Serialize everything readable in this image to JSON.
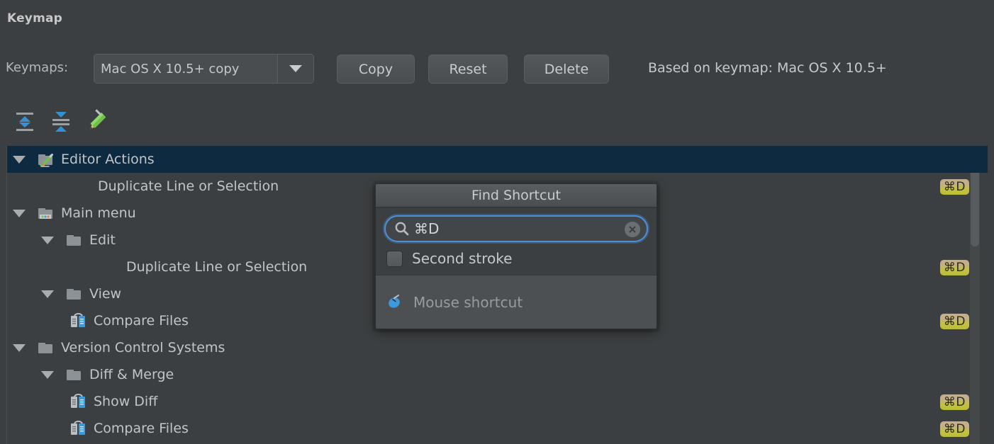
{
  "header": {
    "title": "Keymap",
    "keymaps_label": "Keymaps:",
    "keymap_selected": "Mac OS X 10.5+ copy",
    "buttons": {
      "copy": "Copy",
      "reset": "Reset",
      "delete": "Delete"
    },
    "based_on": "Based on keymap: Mac OS X 10.5+"
  },
  "toolbar": {
    "icons": [
      {
        "name": "expand-all-icon"
      },
      {
        "name": "collapse-all-icon"
      },
      {
        "name": "edit-pencil-icon"
      }
    ],
    "search_value": "",
    "search_placeholder": "",
    "find_shortcut_icon": "find-by-shortcut-icon",
    "clear_icon": "clear-filter-icon"
  },
  "tree": {
    "rows": [
      {
        "label": "Editor Actions",
        "indent": 0,
        "twisty": "expanded",
        "icon": "editor-actions-folder-icon",
        "selected": true,
        "shortcut": ""
      },
      {
        "label": "Duplicate Line or Selection",
        "indent": 3,
        "twisty": "none",
        "icon": "none",
        "selected": false,
        "shortcut": "⌘D"
      },
      {
        "label": "Main menu",
        "indent": 0,
        "twisty": "expanded",
        "icon": "main-menu-folder-icon",
        "selected": false,
        "shortcut": ""
      },
      {
        "label": "Edit",
        "indent": 1,
        "twisty": "expanded",
        "icon": "folder-icon",
        "selected": false,
        "shortcut": ""
      },
      {
        "label": "Duplicate Line or Selection",
        "indent": 4,
        "twisty": "none",
        "icon": "none",
        "selected": false,
        "shortcut": "⌘D"
      },
      {
        "label": "View",
        "indent": 1,
        "twisty": "expanded",
        "icon": "folder-icon",
        "selected": false,
        "shortcut": ""
      },
      {
        "label": "Compare Files",
        "indent": 2,
        "twisty": "none",
        "icon": "compare-files-icon",
        "selected": false,
        "shortcut": "⌘D"
      },
      {
        "label": "Version Control Systems",
        "indent": 0,
        "twisty": "expanded",
        "icon": "folder-icon",
        "selected": false,
        "shortcut": ""
      },
      {
        "label": "Diff & Merge",
        "indent": 1,
        "twisty": "expanded",
        "icon": "folder-icon",
        "selected": false,
        "shortcut": ""
      },
      {
        "label": "Show Diff",
        "indent": 2,
        "twisty": "none",
        "icon": "compare-files-icon",
        "selected": false,
        "shortcut": "⌘D"
      },
      {
        "label": "Compare Files",
        "indent": 2,
        "twisty": "none",
        "icon": "compare-files-icon",
        "selected": false,
        "shortcut": "⌘D"
      }
    ]
  },
  "popup": {
    "title": "Find Shortcut",
    "search_value": "⌘D",
    "second_stroke_label": "Second stroke",
    "second_stroke_checked": false,
    "mouse_shortcut_label": "Mouse shortcut"
  },
  "colors": {
    "window_bg": "#3c3f41",
    "selection_bg": "#0d2a41",
    "badge_bg": "#bcbc3c",
    "focus_ring": "#4a90d9",
    "accent_blue": "#3592d2",
    "danger_red": "#e05a4f"
  }
}
